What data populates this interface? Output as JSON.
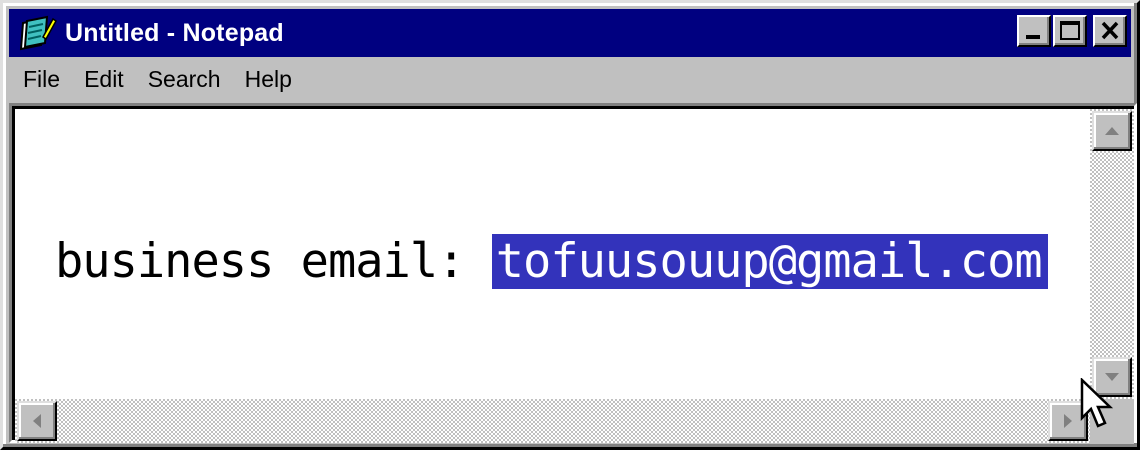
{
  "window": {
    "title": "Untitled - Notepad",
    "app_icon": "notepad-icon",
    "buttons": [
      "minimize-icon",
      "maximize-icon",
      "close-icon"
    ]
  },
  "menubar": {
    "items": [
      {
        "label": "File"
      },
      {
        "label": "Edit"
      },
      {
        "label": "Search"
      },
      {
        "label": "Help"
      }
    ]
  },
  "document": {
    "text_before_selection": "business email: ",
    "selected_text": "tofuusouup@gmail.com"
  },
  "colors": {
    "titlebar": "#000080",
    "selection": "#3333bb",
    "chrome": "#c0c0c0"
  },
  "icons": {
    "scroll_up": "arrow-up-icon",
    "scroll_down": "arrow-down-icon",
    "scroll_left": "arrow-left-icon",
    "scroll_right": "arrow-right-icon",
    "cursor": "mouse-pointer-icon"
  }
}
